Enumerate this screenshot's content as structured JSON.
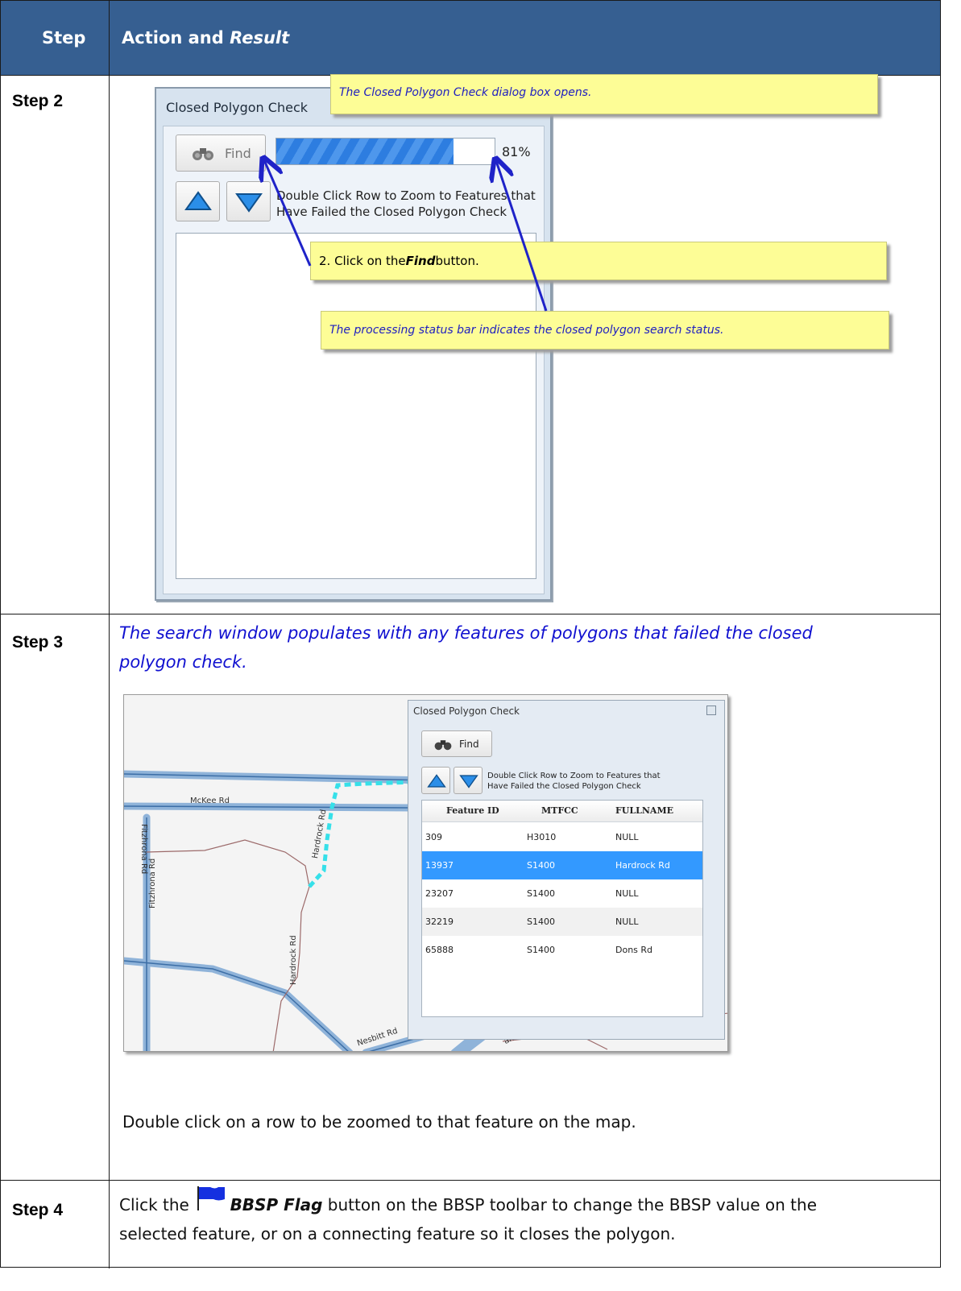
{
  "header": {
    "step": "Step",
    "action": "Action and",
    "result": "Result"
  },
  "step2": {
    "label": "Step 2",
    "dialog": {
      "title": "Closed Polygon Check",
      "find_label": "Find",
      "progress": 0.81,
      "progress_text": "81%",
      "hint_line1": "Double Click Row to Zoom to Features that",
      "hint_line2": "Have Failed the Closed Polygon Check"
    },
    "callout_open": "The Closed Polygon Check dialog box opens.",
    "callout_click_prefix": "2. Click on the ",
    "callout_click_find": "Find",
    "callout_click_suffix": " button.",
    "callout_status": "The processing status bar indicates the closed polygon search status."
  },
  "step3": {
    "label": "Step 3",
    "caption_line1": "The search window populates with any features of polygons that failed the closed",
    "caption_line2": "polygon check.",
    "map_labels": {
      "mckee": "McKee Rd",
      "fitzhrona1": "Fitzhrona Rd",
      "fitzhrona2": "Fitzhrona Rd",
      "hardrock1": "Hardrock Rd",
      "hardrock2": "Hardrock Rd",
      "nesbitt": "Nesbitt Rd",
      "abandoned": "andoned RR"
    },
    "dialog": {
      "title": "Closed Polygon Check",
      "find_label": "Find",
      "hint_line1": "Double Click Row to Zoom to Features that",
      "hint_line2": "Have Failed the Closed Polygon Check",
      "columns": [
        "Feature ID",
        "MTFCC",
        "FULLNAME"
      ],
      "rows": [
        [
          "309",
          "H3010",
          "NULL"
        ],
        [
          "13937",
          "S1400",
          "Hardrock Rd"
        ],
        [
          "23207",
          "S1400",
          "NULL"
        ],
        [
          "32219",
          "S1400",
          "NULL"
        ],
        [
          "65888",
          "S1400",
          "Dons Rd"
        ]
      ]
    },
    "note": "Double click on a row to be zoomed to that feature on the map."
  },
  "step4": {
    "label": "Step 4",
    "line1_prefix": "Click the",
    "line1_bold": "BBSP Flag",
    "line1_suffix": " button on the BBSP toolbar to change the BBSP value on the",
    "line2": "selected feature, or on a connecting feature so it closes the polygon."
  },
  "colors": {
    "header_bg": "#365f91",
    "callout_bg": "#fdfd96",
    "selected_row": "#3399ff"
  }
}
